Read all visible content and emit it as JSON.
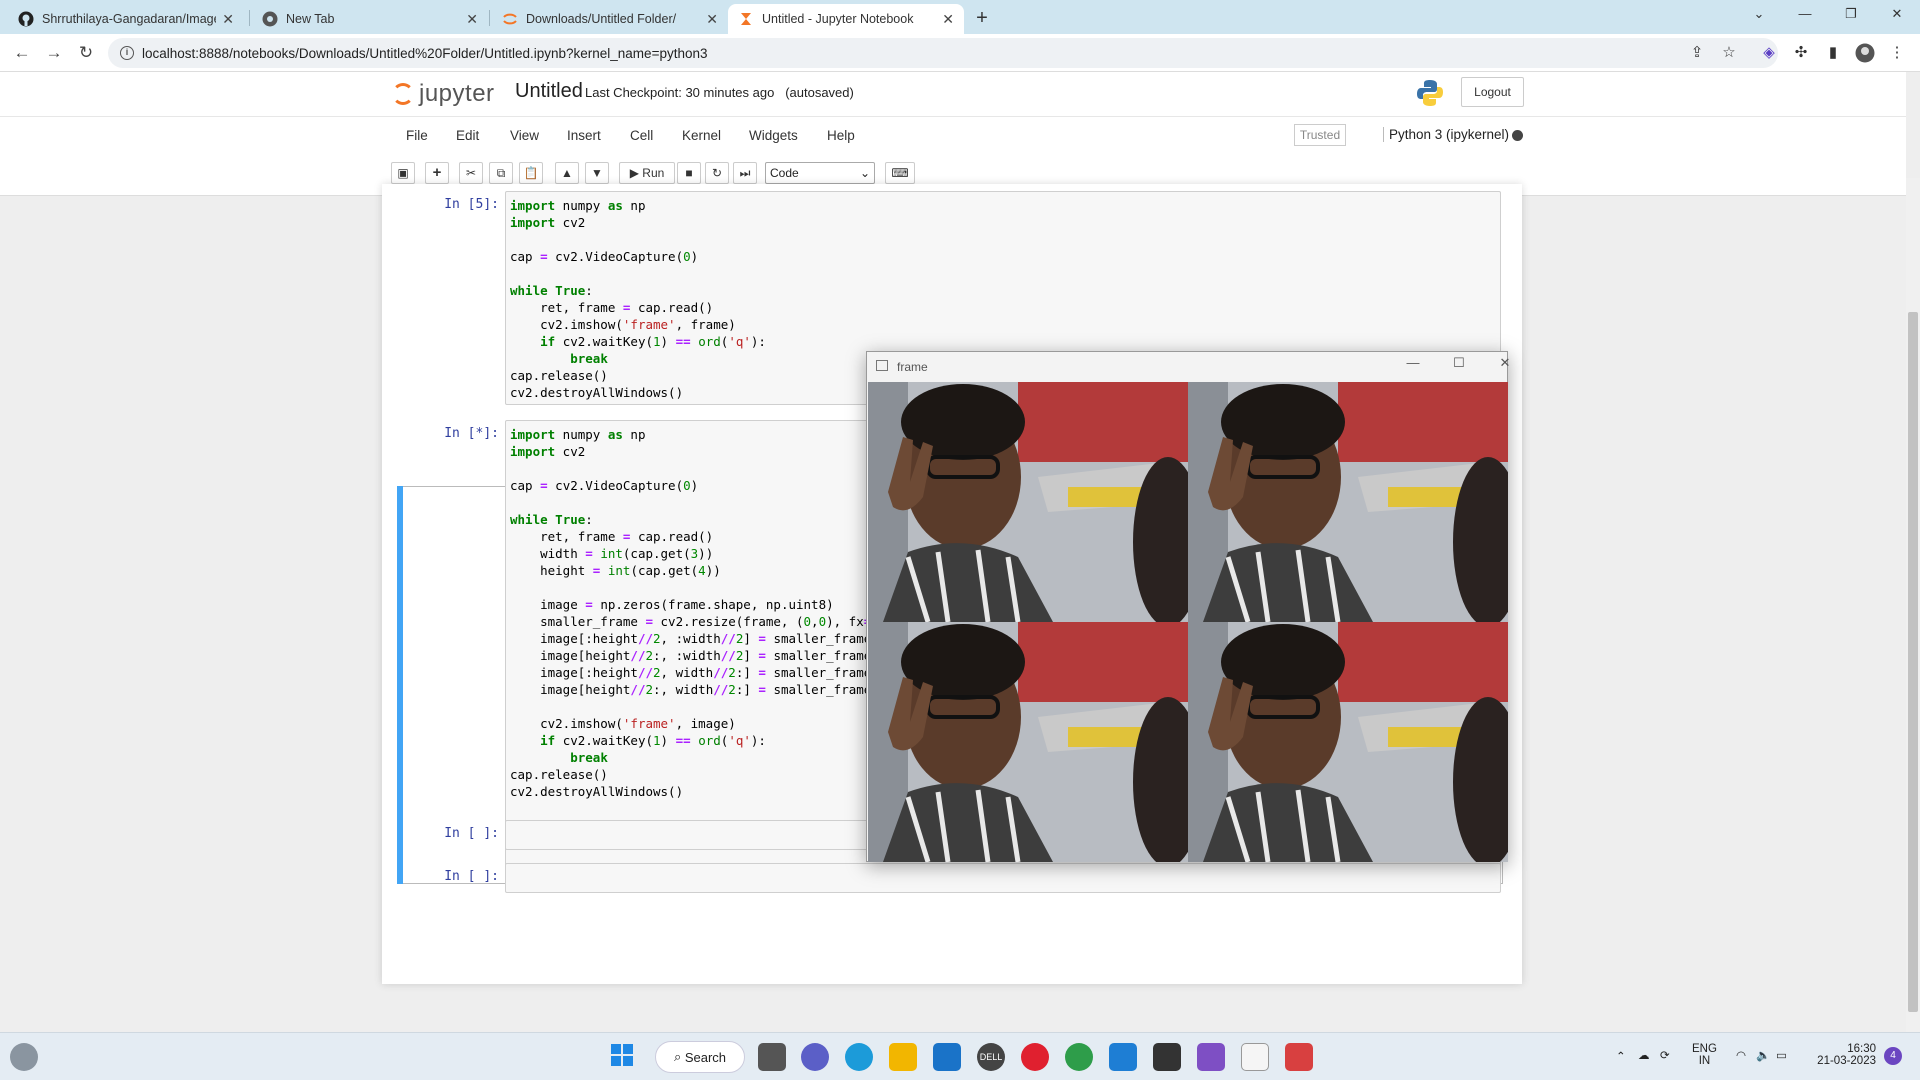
{
  "browser": {
    "tabs": [
      {
        "title": "Shrruthilaya-Gangadaran/Image",
        "icon": "github-icon"
      },
      {
        "title": "New Tab",
        "icon": "chrome-icon"
      },
      {
        "title": "Downloads/Untitled Folder/",
        "icon": "jupyter-icon"
      },
      {
        "title": "Untitled - Jupyter Notebook",
        "icon": "jupyter-icon"
      }
    ],
    "url": "localhost:8888/notebooks/Downloads/Untitled%20Folder/Untitled.ipynb?kernel_name=python3"
  },
  "jupyter": {
    "logo_text": "jupyter",
    "notebook_name": "Untitled",
    "checkpoint": "Last Checkpoint: 30 minutes ago",
    "autosaved": "(autosaved)",
    "logout": "Logout",
    "menu": [
      "File",
      "Edit",
      "View",
      "Insert",
      "Cell",
      "Kernel",
      "Widgets",
      "Help"
    ],
    "trusted": "Trusted",
    "kernel": "Python 3 (ipykernel)",
    "run_label": "Run",
    "cell_type": "Code"
  },
  "cells": [
    {
      "prompt": "In [5]:"
    },
    {
      "prompt": "In [*]:"
    },
    {
      "prompt": "In [ ]:"
    },
    {
      "prompt": "In [ ]:"
    }
  ],
  "frame_window": {
    "title": "frame"
  },
  "taskbar": {
    "search": "Search",
    "lang_top": "ENG",
    "lang_bottom": "IN",
    "time": "16:30",
    "date": "21-03-2023",
    "notif_count": "4"
  }
}
